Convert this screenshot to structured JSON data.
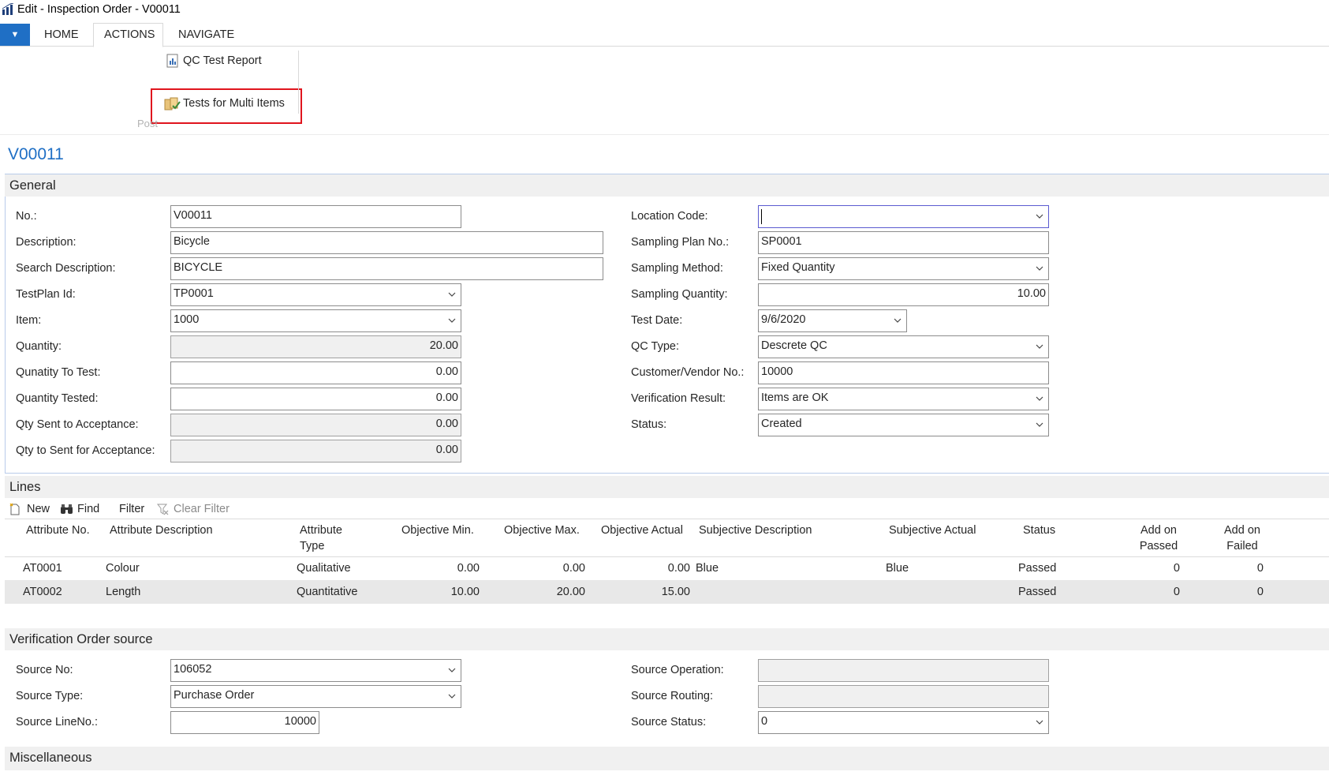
{
  "window": {
    "title": "Edit - Inspection Order - V00011"
  },
  "ribbon": {
    "tabs": [
      "HOME",
      "ACTIONS",
      "NAVIGATE"
    ],
    "active_tab": "ACTIONS",
    "app_menu_glyph": "▼",
    "actions": {
      "qc_test_report": "QC Test Report",
      "tests_for_multi_items": "Tests for Multi Items"
    },
    "group_label": "Post",
    "highlight_color": "#e0151e"
  },
  "page_title": "V00011",
  "general": {
    "header": "General",
    "left": {
      "no": {
        "label": "No.:",
        "value": "V00011"
      },
      "description": {
        "label": "Description:",
        "value": "Bicycle"
      },
      "search_description": {
        "label": "Search Description:",
        "value": "BICYCLE"
      },
      "testplan_id": {
        "label": "TestPlan Id:",
        "value": "TP0001"
      },
      "item": {
        "label": "Item:",
        "value": "1000"
      },
      "quantity": {
        "label": "Quantity:",
        "value": "20.00"
      },
      "qty_to_test": {
        "label": "Qunatity To Test:",
        "value": "0.00"
      },
      "qty_tested": {
        "label": "Quantity Tested:",
        "value": "0.00"
      },
      "qty_sent_acceptance": {
        "label": "Qty Sent to Acceptance:",
        "value": "0.00"
      },
      "qty_to_sent_acceptance": {
        "label": "Qty to Sent for Acceptance:",
        "value": "0.00"
      }
    },
    "right": {
      "location_code": {
        "label": "Location Code:",
        "value": ""
      },
      "sampling_plan_no": {
        "label": "Sampling Plan No.:",
        "value": "SP0001"
      },
      "sampling_method": {
        "label": "Sampling Method:",
        "value": "Fixed Quantity"
      },
      "sampling_quantity": {
        "label": "Sampling Quantity:",
        "value": "10.00"
      },
      "test_date": {
        "label": "Test Date:",
        "value": "9/6/2020"
      },
      "qc_type": {
        "label": "QC Type:",
        "value": "Descrete QC"
      },
      "customer_vendor_no": {
        "label": "Customer/Vendor No.:",
        "value": "10000"
      },
      "verification_result": {
        "label": "Verification Result:",
        "value": "Items are OK"
      },
      "status": {
        "label": "Status:",
        "value": "Created"
      }
    }
  },
  "lines": {
    "header": "Lines",
    "toolbar": {
      "new": "New",
      "find": "Find",
      "filter": "Filter",
      "clear_filter": "Clear Filter"
    },
    "columns": {
      "attribute_no": "Attribute No.",
      "attribute_description": "Attribute Description",
      "attribute_type_1": "Attribute",
      "attribute_type_2": "Type",
      "objective_min": "Objective Min.",
      "objective_max": "Objective Max.",
      "objective_actual": "Objective Actual",
      "subjective_description": "Subjective Description",
      "subjective_actual": "Subjective Actual",
      "status": "Status",
      "add_on_passed_1": "Add on",
      "add_on_passed_2": "Passed",
      "add_on_failed_1": "Add on",
      "add_on_failed_2": "Failed"
    },
    "rows": [
      {
        "attribute_no": "AT0001",
        "description": "Colour",
        "type": "Qualitative",
        "obj_min": "0.00",
        "obj_max": "0.00",
        "obj_actual": "0.00",
        "subj_desc": "Blue",
        "subj_actual": "Blue",
        "status": "Passed",
        "add_passed": "0",
        "add_failed": "0"
      },
      {
        "attribute_no": "AT0002",
        "description": "Length",
        "type": "Quantitative",
        "obj_min": "10.00",
        "obj_max": "20.00",
        "obj_actual": "15.00",
        "subj_desc": "",
        "subj_actual": "",
        "status": "Passed",
        "add_passed": "0",
        "add_failed": "0"
      }
    ]
  },
  "verification_source": {
    "header": "Verification Order source",
    "source_no": {
      "label": "Source No:",
      "value": "106052"
    },
    "source_type": {
      "label": "Source Type:",
      "value": "Purchase Order"
    },
    "source_line_no": {
      "label": "Source LineNo.:",
      "value": "10000"
    },
    "source_operation": {
      "label": "Source Operation:",
      "value": ""
    },
    "source_routing": {
      "label": "Source Routing:",
      "value": ""
    },
    "source_status": {
      "label": "Source Status:",
      "value": "0"
    }
  },
  "misc": {
    "header": "Miscellaneous"
  }
}
